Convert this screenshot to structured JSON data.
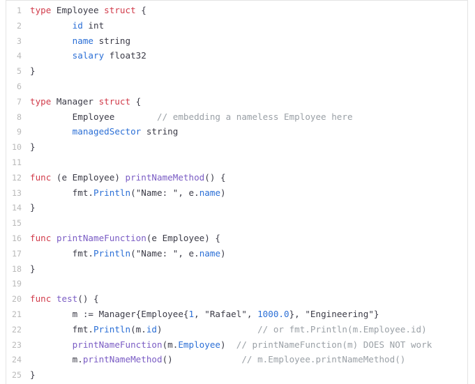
{
  "editor": {
    "language": "go",
    "background": "#ffffff",
    "gutter_color": "#b9b9b9",
    "border_color": "#e4e4e4",
    "colors": {
      "keyword": "#d13b4a",
      "function": "#7a5cc4",
      "property": "#2b6fd6",
      "number": "#2b6fd6",
      "string": "#3b3b47",
      "comment": "#9aa0a6",
      "plain": "#3b3b47"
    },
    "line_numbers": [
      "1",
      "2",
      "3",
      "4",
      "5",
      "6",
      "7",
      "8",
      "9",
      "10",
      "11",
      "12",
      "13",
      "14",
      "15",
      "16",
      "17",
      "18",
      "19",
      "20",
      "21",
      "22",
      "23",
      "24",
      "25"
    ],
    "lines": [
      {
        "n": "1",
        "tokens": [
          {
            "t": "type ",
            "c": "kw"
          },
          {
            "t": "Employee ",
            "c": "plain"
          },
          {
            "t": "struct",
            "c": "kw"
          },
          {
            "t": " {",
            "c": "punct"
          }
        ]
      },
      {
        "n": "2",
        "tokens": [
          {
            "t": "        ",
            "c": "plain"
          },
          {
            "t": "id",
            "c": "prop"
          },
          {
            "t": " int",
            "c": "plain"
          }
        ]
      },
      {
        "n": "3",
        "tokens": [
          {
            "t": "        ",
            "c": "plain"
          },
          {
            "t": "name",
            "c": "prop"
          },
          {
            "t": " string",
            "c": "plain"
          }
        ]
      },
      {
        "n": "4",
        "tokens": [
          {
            "t": "        ",
            "c": "plain"
          },
          {
            "t": "salary",
            "c": "prop"
          },
          {
            "t": " float32",
            "c": "plain"
          }
        ]
      },
      {
        "n": "5",
        "tokens": [
          {
            "t": "}",
            "c": "punct"
          }
        ]
      },
      {
        "n": "6",
        "tokens": [
          {
            "t": "",
            "c": "plain"
          }
        ]
      },
      {
        "n": "7",
        "tokens": [
          {
            "t": "type ",
            "c": "kw"
          },
          {
            "t": "Manager ",
            "c": "plain"
          },
          {
            "t": "struct",
            "c": "kw"
          },
          {
            "t": " {",
            "c": "punct"
          }
        ]
      },
      {
        "n": "8",
        "tokens": [
          {
            "t": "        ",
            "c": "plain"
          },
          {
            "t": "Employee",
            "c": "plain"
          },
          {
            "t": "        ",
            "c": "plain"
          },
          {
            "t": "// embedding a nameless Employee here",
            "c": "comment"
          }
        ]
      },
      {
        "n": "9",
        "tokens": [
          {
            "t": "        ",
            "c": "plain"
          },
          {
            "t": "managedSector",
            "c": "prop"
          },
          {
            "t": " string",
            "c": "plain"
          }
        ]
      },
      {
        "n": "10",
        "tokens": [
          {
            "t": "}",
            "c": "punct"
          }
        ]
      },
      {
        "n": "11",
        "tokens": [
          {
            "t": "",
            "c": "plain"
          }
        ]
      },
      {
        "n": "12",
        "tokens": [
          {
            "t": "func",
            "c": "kw"
          },
          {
            "t": " (e Employee) ",
            "c": "plain"
          },
          {
            "t": "printNameMethod",
            "c": "fn"
          },
          {
            "t": "() {",
            "c": "punct"
          }
        ]
      },
      {
        "n": "13",
        "tokens": [
          {
            "t": "        ",
            "c": "plain"
          },
          {
            "t": "fmt.",
            "c": "plain"
          },
          {
            "t": "Println",
            "c": "prop"
          },
          {
            "t": "(",
            "c": "punct"
          },
          {
            "t": "\"Name: \"",
            "c": "str"
          },
          {
            "t": ", e.",
            "c": "plain"
          },
          {
            "t": "name",
            "c": "prop"
          },
          {
            "t": ")",
            "c": "punct"
          }
        ]
      },
      {
        "n": "14",
        "tokens": [
          {
            "t": "}",
            "c": "punct"
          }
        ]
      },
      {
        "n": "15",
        "tokens": [
          {
            "t": "",
            "c": "plain"
          }
        ]
      },
      {
        "n": "16",
        "tokens": [
          {
            "t": "func",
            "c": "kw"
          },
          {
            "t": " ",
            "c": "plain"
          },
          {
            "t": "printNameFunction",
            "c": "fn"
          },
          {
            "t": "(e Employee) {",
            "c": "plain"
          }
        ]
      },
      {
        "n": "17",
        "tokens": [
          {
            "t": "        ",
            "c": "plain"
          },
          {
            "t": "fmt.",
            "c": "plain"
          },
          {
            "t": "Println",
            "c": "prop"
          },
          {
            "t": "(",
            "c": "punct"
          },
          {
            "t": "\"Name: \"",
            "c": "str"
          },
          {
            "t": ", e.",
            "c": "plain"
          },
          {
            "t": "name",
            "c": "prop"
          },
          {
            "t": ")",
            "c": "punct"
          }
        ]
      },
      {
        "n": "18",
        "tokens": [
          {
            "t": "}",
            "c": "punct"
          }
        ]
      },
      {
        "n": "19",
        "tokens": [
          {
            "t": "",
            "c": "plain"
          }
        ]
      },
      {
        "n": "20",
        "tokens": [
          {
            "t": "func",
            "c": "kw"
          },
          {
            "t": " ",
            "c": "plain"
          },
          {
            "t": "test",
            "c": "fn"
          },
          {
            "t": "() {",
            "c": "punct"
          }
        ]
      },
      {
        "n": "21",
        "tokens": [
          {
            "t": "        ",
            "c": "plain"
          },
          {
            "t": "m := Manager{Employee{",
            "c": "plain"
          },
          {
            "t": "1",
            "c": "num"
          },
          {
            "t": ", ",
            "c": "plain"
          },
          {
            "t": "\"Rafael\"",
            "c": "str"
          },
          {
            "t": ", ",
            "c": "plain"
          },
          {
            "t": "1000.0",
            "c": "num"
          },
          {
            "t": "}, ",
            "c": "plain"
          },
          {
            "t": "\"Engineering\"",
            "c": "str"
          },
          {
            "t": "}",
            "c": "punct"
          }
        ]
      },
      {
        "n": "22",
        "tokens": [
          {
            "t": "        ",
            "c": "plain"
          },
          {
            "t": "fmt.",
            "c": "plain"
          },
          {
            "t": "Println",
            "c": "prop"
          },
          {
            "t": "(m.",
            "c": "plain"
          },
          {
            "t": "id",
            "c": "prop"
          },
          {
            "t": ")",
            "c": "punct"
          },
          {
            "t": "                  ",
            "c": "plain"
          },
          {
            "t": "// or fmt.Println(m.Employee.id)",
            "c": "comment"
          }
        ]
      },
      {
        "n": "23",
        "tokens": [
          {
            "t": "        ",
            "c": "plain"
          },
          {
            "t": "printNameFunction",
            "c": "fn"
          },
          {
            "t": "(m.",
            "c": "plain"
          },
          {
            "t": "Employee",
            "c": "prop"
          },
          {
            "t": ")",
            "c": "punct"
          },
          {
            "t": "  ",
            "c": "plain"
          },
          {
            "t": "// printNameFunction(m) DOES NOT work",
            "c": "comment"
          }
        ]
      },
      {
        "n": "24",
        "tokens": [
          {
            "t": "        ",
            "c": "plain"
          },
          {
            "t": "m.",
            "c": "plain"
          },
          {
            "t": "printNameMethod",
            "c": "fn"
          },
          {
            "t": "()",
            "c": "punct"
          },
          {
            "t": "             ",
            "c": "plain"
          },
          {
            "t": "// m.Employee.printNameMethod()",
            "c": "comment"
          }
        ]
      },
      {
        "n": "25",
        "tokens": [
          {
            "t": "}",
            "c": "punct"
          }
        ]
      }
    ]
  }
}
